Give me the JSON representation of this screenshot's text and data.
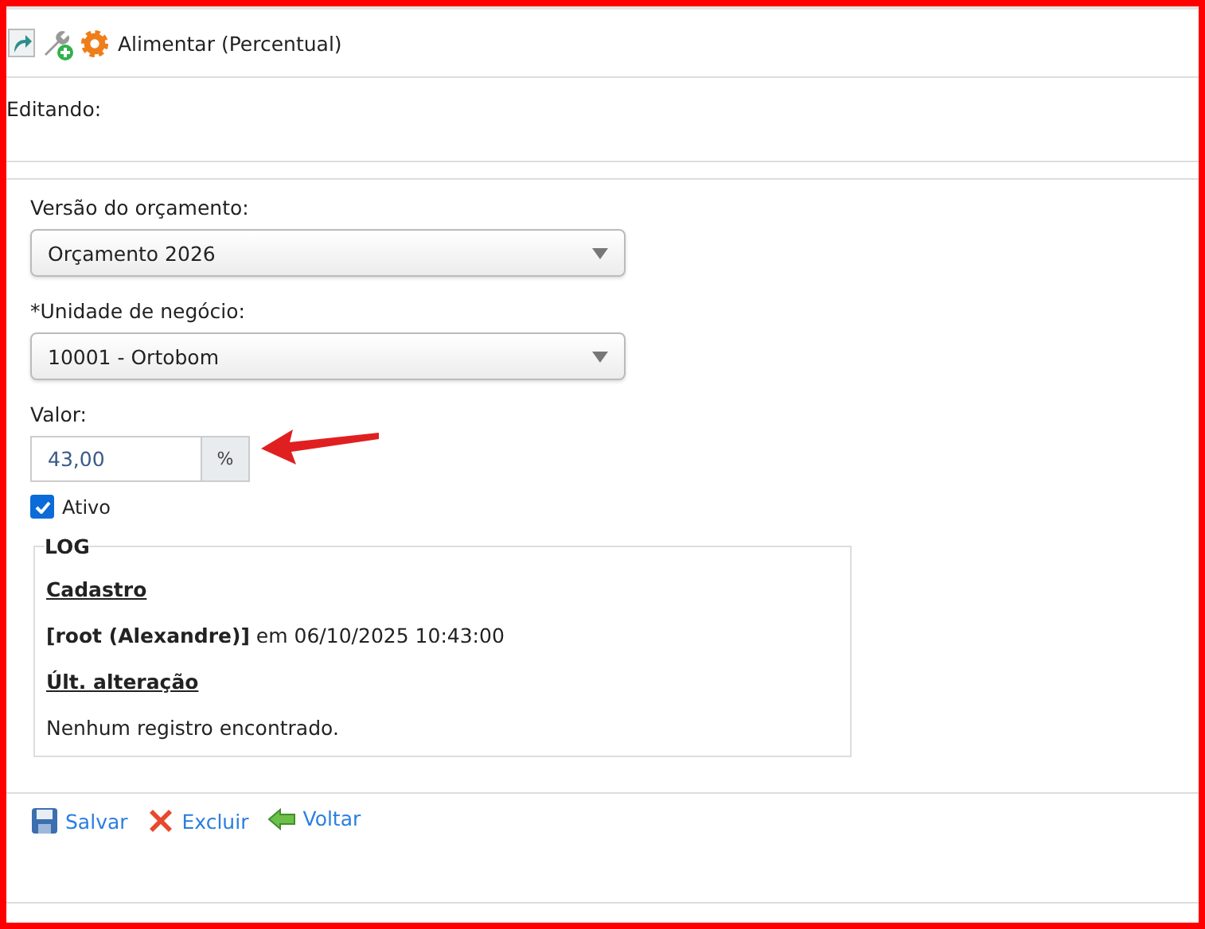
{
  "header": {
    "title": "Alimentar (Percentual)"
  },
  "mode_label": "Editando:",
  "fields": [
    {
      "kind": "select",
      "label": "Versão do orçamento:",
      "value": "Orçamento 2026"
    },
    {
      "kind": "select",
      "label": "*Unidade de negócio:",
      "value": "10001 - Ortobom"
    },
    {
      "kind": "number",
      "label": "Valor:",
      "value": "43,00",
      "suffix": "%"
    }
  ],
  "active": {
    "label": "Ativo",
    "checked": true
  },
  "log": {
    "legend": "LOG",
    "created_heading": "Cadastro",
    "created_entry": "**[root (Alexandre)]** em 06/10/2025 10:43:00",
    "changed_heading": "Últ. alteração",
    "changed_entry": "Nenhum registro encontrado."
  },
  "actions": [
    {
      "kind": "save",
      "label": "Salvar"
    },
    {
      "kind": "delete",
      "label": "Excluir"
    },
    {
      "kind": "back",
      "label": "Voltar"
    }
  ]
}
